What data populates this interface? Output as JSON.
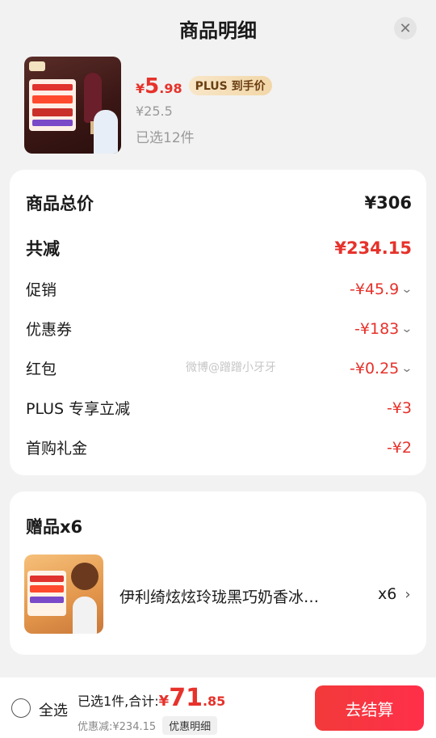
{
  "header": {
    "title": "商品明细",
    "close_icon": "close-icon"
  },
  "product": {
    "price_symbol": "¥",
    "price_int": "5",
    "price_dec": ".98",
    "plus_badge": "PLUS 到手价",
    "original_price": "¥25.5",
    "selected_count": "已选12件"
  },
  "summary": {
    "total_label": "商品总价",
    "total_value": "¥306",
    "reduced_label": "共减",
    "reduced_value": "¥234.15",
    "rows": [
      {
        "label": "促销",
        "value": "-¥45.9",
        "expandable": true
      },
      {
        "label": "优惠券",
        "value": "-¥183",
        "expandable": true
      },
      {
        "label": "红包",
        "value": "-¥0.25",
        "expandable": true
      },
      {
        "label": "PLUS 专享立减",
        "value": "-¥3",
        "expandable": false
      },
      {
        "label": "首购礼金",
        "value": "-¥2",
        "expandable": false
      }
    ],
    "watermark": "微博@蹭蹭小牙牙"
  },
  "gifts": {
    "title": "赠品x6",
    "item_name": "伊利绮炫炫玲珑黑巧奶香冰…",
    "item_qty": "x6"
  },
  "bottom_bar": {
    "select_all": "全选",
    "total_label": "已选1件,合计:",
    "total_symbol": "¥",
    "total_int": "71",
    "total_dec": ".85",
    "discount_text": "优惠减:¥234.15",
    "detail_chip": "优惠明细",
    "checkout_label": "去结算"
  },
  "colors": {
    "accent_red": "#e6322b",
    "plus_gold": "#f2d7a8",
    "checkout_red": "#f23a3a"
  }
}
